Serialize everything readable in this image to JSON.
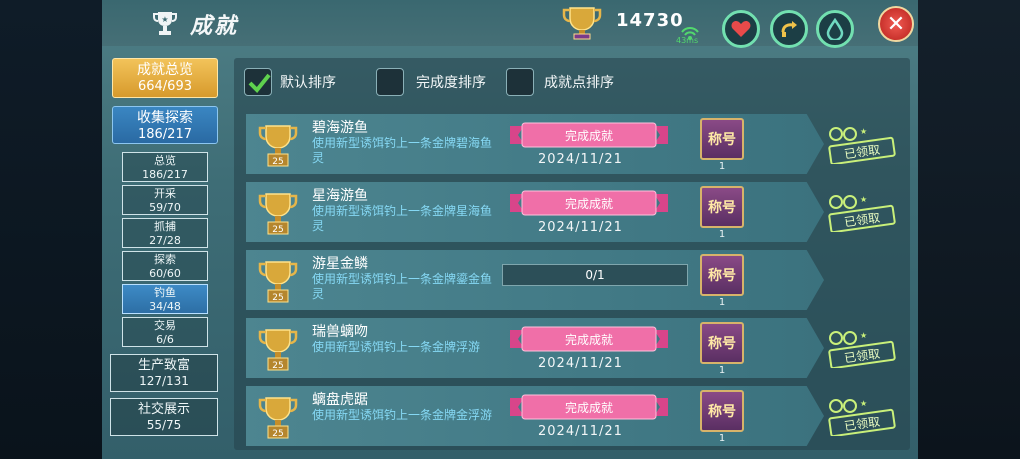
{
  "header": {
    "title": "成就",
    "score": "14730",
    "ping": "43ms",
    "colors": {
      "accent": "#72e0b0",
      "close": "#d8322c"
    }
  },
  "sidebar": {
    "top": {
      "label": "成就总览",
      "count": "664/693"
    },
    "collect": {
      "label": "收集探索",
      "count": "186/217"
    },
    "subs": [
      {
        "label": "总览",
        "count": "186/217"
      },
      {
        "label": "开采",
        "count": "59/70"
      },
      {
        "label": "抓捕",
        "count": "27/28"
      },
      {
        "label": "探索",
        "count": "60/60"
      },
      {
        "label": "钓鱼",
        "count": "34/48"
      },
      {
        "label": "交易",
        "count": "6/6"
      }
    ],
    "cats": [
      {
        "label": "生产致富",
        "count": "127/131"
      },
      {
        "label": "社交展示",
        "count": "55/75"
      }
    ]
  },
  "sort": {
    "default": "默认排序",
    "completion": "完成度排序",
    "points": "成就点排序"
  },
  "rows": [
    {
      "name": "碧海游鱼",
      "desc": "使用新型诱饵钓上一条金牌碧海鱼灵",
      "points": "25",
      "status": "完成成就",
      "date": "2024/11/21",
      "badge": "称号",
      "badge_count": "1",
      "claim": "已领取"
    },
    {
      "name": "星海游鱼",
      "desc": "使用新型诱饵钓上一条金牌星海鱼灵",
      "points": "25",
      "status": "完成成就",
      "date": "2024/11/21",
      "badge": "称号",
      "badge_count": "1",
      "claim": "已领取"
    },
    {
      "name": "游星金鳞",
      "desc": "使用新型诱饵钓上一条金牌鎏金鱼灵",
      "points": "25",
      "progress": "0/1",
      "badge": "称号",
      "badge_count": "1"
    },
    {
      "name": "瑞兽螭吻",
      "desc": "使用新型诱饵钓上一条金牌浮游",
      "points": "25",
      "status": "完成成就",
      "date": "2024/11/21",
      "badge": "称号",
      "badge_count": "1",
      "claim": "已领取"
    },
    {
      "name": "螭盘虎踞",
      "desc": "使用新型诱饵钓上一条金牌金浮游",
      "points": "25",
      "status": "完成成就",
      "date": "2024/11/21",
      "badge": "称号",
      "badge_count": "1",
      "claim": "已领取"
    }
  ]
}
